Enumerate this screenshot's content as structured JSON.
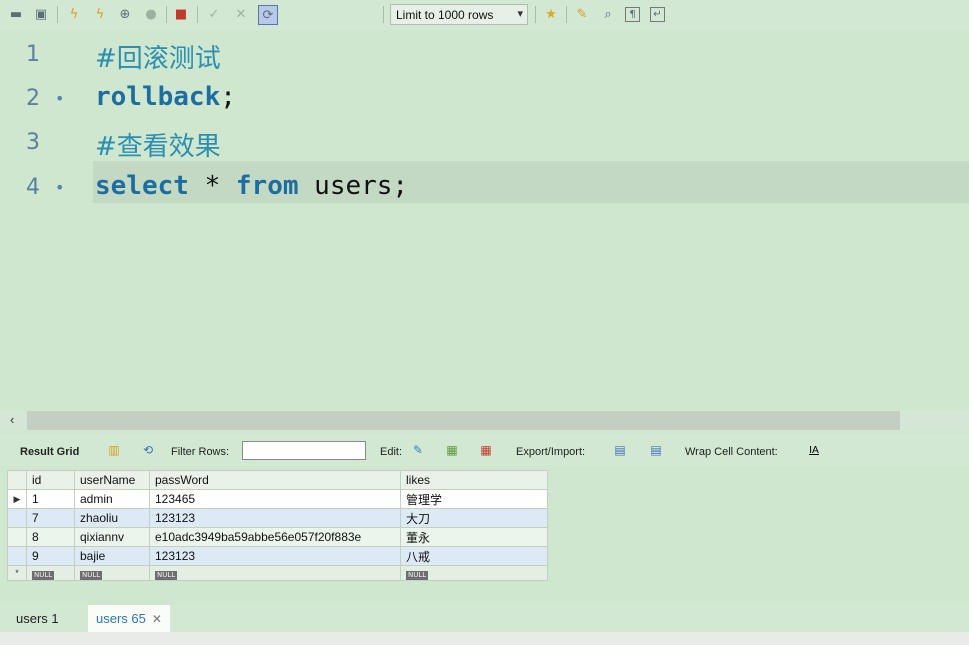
{
  "toolbar": {
    "icons": [
      "folder-open-icon",
      "save-icon",
      "execute-icon",
      "execute-current-icon",
      "explain-icon",
      "stop-icon",
      "toggle-error-icon",
      "commit-icon",
      "rollback-icon",
      "autocommit-icon",
      "limit-rows-label",
      "add-snippet-icon",
      "beautify-icon",
      "find-icon",
      "invisible-chars-icon",
      "word-wrap-icon"
    ],
    "limit_select": "Limit to 1000 rows"
  },
  "editor": {
    "lines": [
      {
        "num": "1",
        "marker": "",
        "parts": [
          {
            "text": "#回滚测试",
            "cls": "comment"
          }
        ]
      },
      {
        "num": "2",
        "marker": "•",
        "parts": [
          {
            "text": "rollback",
            "cls": "kw"
          },
          {
            "text": ";",
            "cls": "plain"
          }
        ]
      },
      {
        "num": "3",
        "marker": "",
        "parts": [
          {
            "text": "#查看效果",
            "cls": "comment"
          }
        ]
      },
      {
        "num": "4",
        "marker": "•",
        "parts": [
          {
            "text": "select",
            "cls": "kw"
          },
          {
            "text": " * ",
            "cls": "plain"
          },
          {
            "text": "from",
            "cls": "kw"
          },
          {
            "text": " users;",
            "cls": "plain"
          }
        ]
      }
    ]
  },
  "result_toolbar": {
    "result_grid": "Result Grid",
    "filter_rows": "Filter Rows:",
    "filter_value": "",
    "edit": "Edit:",
    "export_import": "Export/Import:",
    "wrap_cell": "Wrap Cell Content:"
  },
  "grid": {
    "columns": [
      "id",
      "userName",
      "passWord",
      "likes"
    ],
    "rows": [
      [
        "1",
        "admin",
        "123465",
        "管理学"
      ],
      [
        "7",
        "zhaoliu",
        "123123",
        "大刀"
      ],
      [
        "8",
        "qixiannv",
        "e10adc3949ba59abbe56e057f20f883e",
        "董永"
      ],
      [
        "9",
        "bajie",
        "123123",
        "八戒"
      ]
    ],
    "null_label": "NULL",
    "new_row_marker": "*",
    "selected_marker": "▶"
  },
  "tabs": [
    {
      "label": "users 1",
      "active": false
    },
    {
      "label": "users 65",
      "active": true,
      "close": "✕"
    }
  ]
}
